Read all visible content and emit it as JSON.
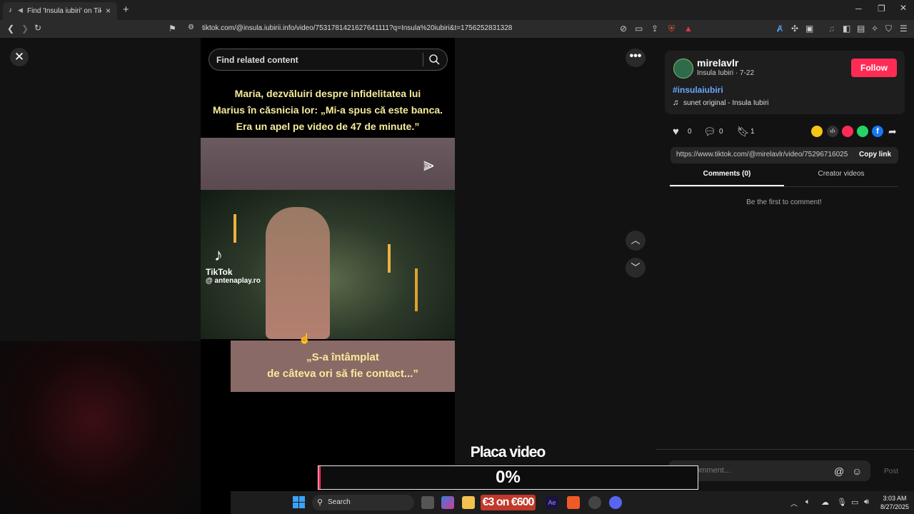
{
  "browser": {
    "tab_title": "Find 'Insula iubiri' on TikTok |",
    "url": "tiktok.com/@insula.iubirii.info/video/7531781421627641111?q=Insula%20iubiri&t=1756252831328"
  },
  "video": {
    "search_placeholder": "Find related content",
    "caption_top": [
      "Maria, dezvăluiri despre infidelitatea lui",
      "Marius în căsnicia lor: „Mi-a spus că este banca.",
      "Era un apel pe video de 47 de minute.”"
    ],
    "watermark": "TikTok",
    "watermark_handle": "@ antenaplay.ro",
    "caption_bottom": [
      "„S-a întâmplat",
      "de câteva ori să fie contact...”"
    ]
  },
  "creator": {
    "username": "mirelavlr",
    "subline": "Insula Iubiri · 7-22",
    "follow_label": "Follow",
    "hashtag": "#insulaiubiri",
    "sound": "sunet original - Insula Iubiri"
  },
  "stats": {
    "likes": "0",
    "comments": "0",
    "saves": "1"
  },
  "share": {
    "link": "https://www.tiktok.com/@mirelavlr/video/75296716025...",
    "copy_label": "Copy link"
  },
  "tabs": {
    "comments": "Comments (0)",
    "creator": "Creator videos"
  },
  "comments": {
    "empty_text": "Be the first to comment!",
    "input_placeholder": "Add comment...",
    "post_label": "Post"
  },
  "overlay": {
    "title": "Placa video",
    "progress_text": "0%",
    "progress_value": 0,
    "accent": "#fe2c55"
  },
  "taskbar": {
    "search_label": "Search",
    "promo": "€3 on €600",
    "time": "3:03 AM",
    "date": "8/27/2025"
  },
  "icons": [
    "close-icon",
    "search-icon",
    "more-icon",
    "chevron-up-icon",
    "chevron-down-icon",
    "heart-icon",
    "comment-icon",
    "bookmark-icon",
    "share-icon",
    "music-icon",
    "at-icon",
    "emoji-icon",
    "mute-icon",
    "volume-icon"
  ]
}
